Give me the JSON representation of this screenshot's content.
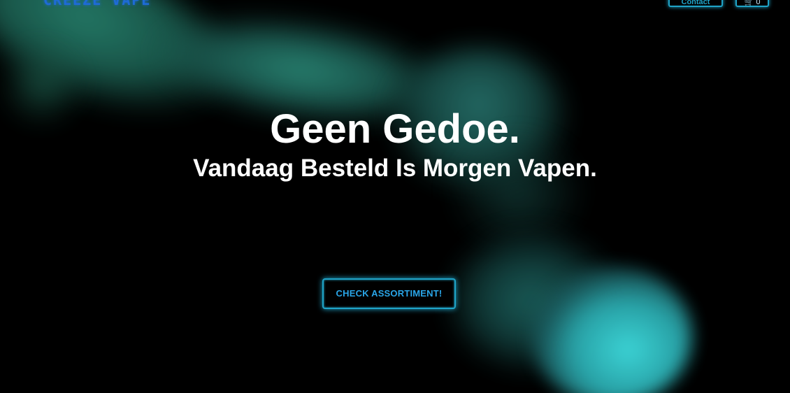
{
  "header": {
    "logo_text": "CREEZE VAPE",
    "contact_label": "Contact",
    "cart_label": "0",
    "cart_icon": "cart-icon"
  },
  "hero": {
    "title": "Geen Gedoe.",
    "subtitle": "Vandaag Besteld Is Morgen Vapen."
  },
  "cta": {
    "label": "CHECK ASSORTIMENT!"
  },
  "colors": {
    "background": "#000000",
    "accent": "#1fa4c8",
    "cta_text": "#2aa6e8",
    "logo": "#1e6bd6",
    "smoke": "#2f9a86",
    "smoke_glow": "#3fe0e2"
  }
}
